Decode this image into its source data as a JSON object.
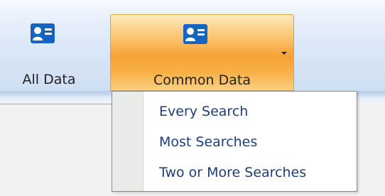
{
  "ribbon": {
    "buttons": [
      {
        "label": "All Data",
        "icon": "contact-card-icon"
      },
      {
        "label": "Common Data",
        "icon": "contact-card-icon",
        "state": "open",
        "has_dropdown": true
      }
    ]
  },
  "dropdown": {
    "items": [
      {
        "label": "Every Search"
      },
      {
        "label": "Most Searches"
      },
      {
        "label": "Two or More Searches"
      }
    ]
  },
  "colors": {
    "icon_blue": "#1565c0",
    "menu_text": "#1f3e78",
    "active_button_orange": "#f6a235",
    "ribbon_blue": "#d3e2f4"
  }
}
